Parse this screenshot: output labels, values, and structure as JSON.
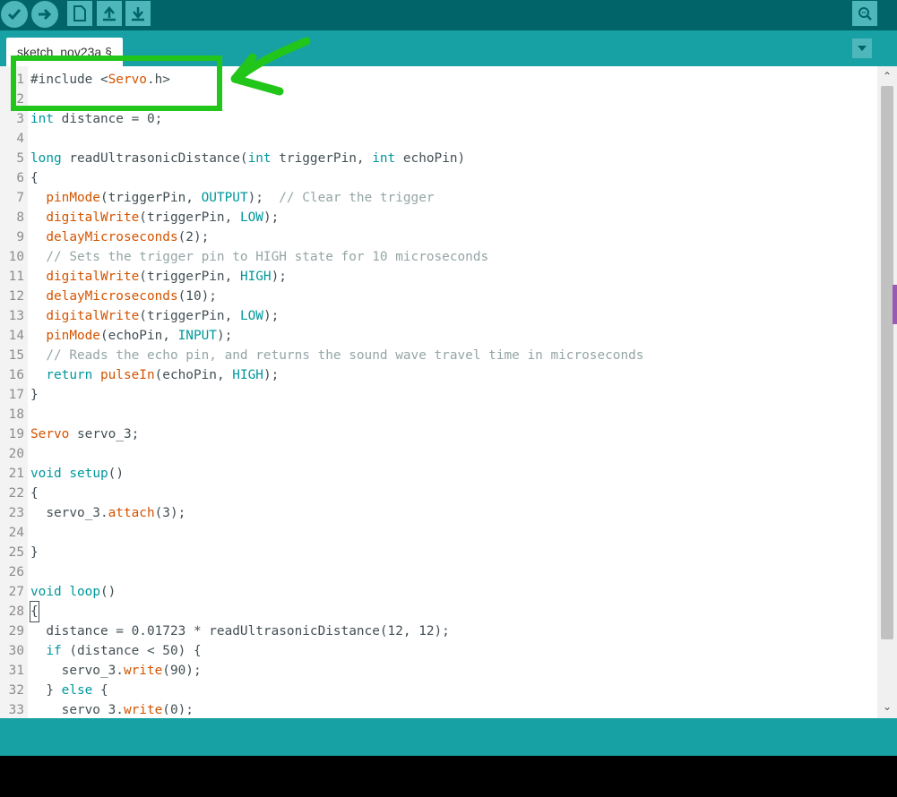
{
  "toolbar": {
    "buttons": [
      "verify-icon",
      "upload-icon",
      "new-icon",
      "open-icon",
      "save-icon",
      "serial-monitor-icon"
    ]
  },
  "tabs": {
    "active_tab": "sketch_nov23a §",
    "menu_icon": "chevron-down-icon"
  },
  "editor": {
    "lines": [
      {
        "n": "1",
        "segs": [
          [
            "pp",
            "#include <"
          ],
          [
            "ty",
            "Servo"
          ],
          [
            "pp",
            ".h>"
          ]
        ]
      },
      {
        "n": "2",
        "segs": []
      },
      {
        "n": "3",
        "segs": [
          [
            "kw",
            "int"
          ],
          [
            "pp",
            " distance = 0;"
          ]
        ]
      },
      {
        "n": "4",
        "segs": []
      },
      {
        "n": "5",
        "segs": [
          [
            "kw",
            "long"
          ],
          [
            "pp",
            " readUltrasonicDistance("
          ],
          [
            "kw",
            "int"
          ],
          [
            "pp",
            " triggerPin, "
          ],
          [
            "kw",
            "int"
          ],
          [
            "pp",
            " echoPin)"
          ]
        ]
      },
      {
        "n": "6",
        "segs": [
          [
            "pp",
            "{"
          ]
        ]
      },
      {
        "n": "7",
        "segs": [
          [
            "pp",
            "  "
          ],
          [
            "fn",
            "pinMode"
          ],
          [
            "pp",
            "(triggerPin, "
          ],
          [
            "kw",
            "OUTPUT"
          ],
          [
            "pp",
            ");  "
          ],
          [
            "cm",
            "// Clear the trigger"
          ]
        ]
      },
      {
        "n": "8",
        "segs": [
          [
            "pp",
            "  "
          ],
          [
            "fn",
            "digitalWrite"
          ],
          [
            "pp",
            "(triggerPin, "
          ],
          [
            "kw",
            "LOW"
          ],
          [
            "pp",
            ");"
          ]
        ]
      },
      {
        "n": "9",
        "segs": [
          [
            "pp",
            "  "
          ],
          [
            "fn",
            "delayMicroseconds"
          ],
          [
            "pp",
            "(2);"
          ]
        ]
      },
      {
        "n": "10",
        "segs": [
          [
            "pp",
            "  "
          ],
          [
            "cm",
            "// Sets the trigger pin to HIGH state for 10 microseconds"
          ]
        ]
      },
      {
        "n": "11",
        "segs": [
          [
            "pp",
            "  "
          ],
          [
            "fn",
            "digitalWrite"
          ],
          [
            "pp",
            "(triggerPin, "
          ],
          [
            "kw",
            "HIGH"
          ],
          [
            "pp",
            ");"
          ]
        ]
      },
      {
        "n": "12",
        "segs": [
          [
            "pp",
            "  "
          ],
          [
            "fn",
            "delayMicroseconds"
          ],
          [
            "pp",
            "(10);"
          ]
        ]
      },
      {
        "n": "13",
        "segs": [
          [
            "pp",
            "  "
          ],
          [
            "fn",
            "digitalWrite"
          ],
          [
            "pp",
            "(triggerPin, "
          ],
          [
            "kw",
            "LOW"
          ],
          [
            "pp",
            ");"
          ]
        ]
      },
      {
        "n": "14",
        "segs": [
          [
            "pp",
            "  "
          ],
          [
            "fn",
            "pinMode"
          ],
          [
            "pp",
            "(echoPin, "
          ],
          [
            "kw",
            "INPUT"
          ],
          [
            "pp",
            ");"
          ]
        ]
      },
      {
        "n": "15",
        "segs": [
          [
            "pp",
            "  "
          ],
          [
            "cm",
            "// Reads the echo pin, and returns the sound wave travel time in microseconds"
          ]
        ]
      },
      {
        "n": "16",
        "segs": [
          [
            "pp",
            "  "
          ],
          [
            "kw",
            "return"
          ],
          [
            "pp",
            " "
          ],
          [
            "fn",
            "pulseIn"
          ],
          [
            "pp",
            "(echoPin, "
          ],
          [
            "kw",
            "HIGH"
          ],
          [
            "pp",
            ");"
          ]
        ]
      },
      {
        "n": "17",
        "segs": [
          [
            "pp",
            "}"
          ]
        ]
      },
      {
        "n": "18",
        "segs": []
      },
      {
        "n": "19",
        "segs": [
          [
            "ty",
            "Servo"
          ],
          [
            "pp",
            " servo_3;"
          ]
        ]
      },
      {
        "n": "20",
        "segs": []
      },
      {
        "n": "21",
        "segs": [
          [
            "kw",
            "void"
          ],
          [
            "pp",
            " "
          ],
          [
            "kw",
            "setup"
          ],
          [
            "pp",
            "()"
          ]
        ]
      },
      {
        "n": "22",
        "segs": [
          [
            "pp",
            "{"
          ]
        ]
      },
      {
        "n": "23",
        "segs": [
          [
            "pp",
            "  servo_3."
          ],
          [
            "fn",
            "attach"
          ],
          [
            "pp",
            "(3);"
          ]
        ]
      },
      {
        "n": "24",
        "segs": []
      },
      {
        "n": "25",
        "segs": [
          [
            "pp",
            "}"
          ]
        ]
      },
      {
        "n": "26",
        "segs": []
      },
      {
        "n": "27",
        "segs": [
          [
            "kw",
            "void"
          ],
          [
            "pp",
            " "
          ],
          [
            "kw",
            "loop"
          ],
          [
            "pp",
            "()"
          ]
        ]
      },
      {
        "n": "28",
        "segs": [
          [
            "brace",
            "{"
          ]
        ]
      },
      {
        "n": "29",
        "segs": [
          [
            "pp",
            "  distance = 0.01723 * readUltrasonicDistance(12, 12);"
          ]
        ]
      },
      {
        "n": "30",
        "segs": [
          [
            "pp",
            "  "
          ],
          [
            "kw",
            "if"
          ],
          [
            "pp",
            " (distance < 50) {"
          ]
        ]
      },
      {
        "n": "31",
        "segs": [
          [
            "pp",
            "    servo_3."
          ],
          [
            "fn",
            "write"
          ],
          [
            "pp",
            "(90);"
          ]
        ]
      },
      {
        "n": "32",
        "segs": [
          [
            "pp",
            "  } "
          ],
          [
            "kw",
            "else"
          ],
          [
            "pp",
            " {"
          ]
        ]
      },
      {
        "n": "33",
        "segs": [
          [
            "pp",
            "    servo_3."
          ],
          [
            "fn",
            "write"
          ],
          [
            "pp",
            "(0);"
          ]
        ]
      }
    ]
  },
  "colors": {
    "toolbar_bg": "#006468",
    "tabbar_bg": "#17a1a5",
    "keyword": "#00979c",
    "function": "#d35400",
    "comment": "#95a5a6",
    "annotation": "#22c51a"
  }
}
